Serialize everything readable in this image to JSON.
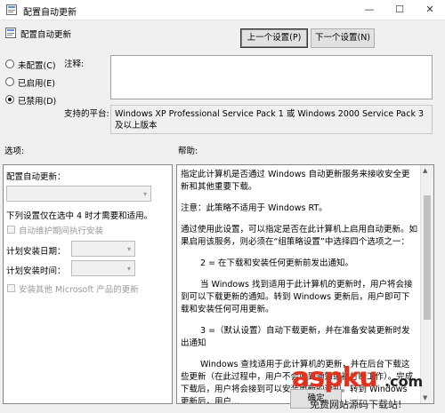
{
  "window": {
    "title": "配置自动更新",
    "minimize_glyph": "—",
    "maximize_glyph": "☐",
    "close_glyph": "✕"
  },
  "header": {
    "policy_name": "配置自动更新",
    "prev_button": "上一个设置(P)",
    "next_button": "下一个设置(N)"
  },
  "state_options": [
    {
      "label": "未配置(C)",
      "selected": false
    },
    {
      "label": "已启用(E)",
      "selected": false
    },
    {
      "label": "已禁用(D)",
      "selected": true
    }
  ],
  "comment": {
    "label": "注释:",
    "value": ""
  },
  "platform": {
    "label": "支持的平台:",
    "value": "Windows XP Professional Service Pack 1 或 Windows 2000 Service Pack 3 及以上版本"
  },
  "options": {
    "section_label": "选项:",
    "configure_label": "配置自动更新：",
    "configure_value": "",
    "desc": "下列设置仅在选中 4 时才需要和适用。",
    "maintenance_checkbox": "自动维护期间执行安装",
    "schedule_day_label": "计划安装日期：",
    "schedule_time_label": "计划安装时间：",
    "other_products_checkbox": "安装其他 Microsoft 产品的更新"
  },
  "help": {
    "section_label": "帮助:",
    "paragraphs": [
      "指定此计算机是否通过 Windows 自动更新服务来接收安全更新和其他重要下载。",
      "注意：此策略不适用于 Windows RT。",
      "通过使用此设置，可以指定是否在此计算机上启用自动更新。如果启用该服务，则必须在“组策略设置”中选择四个选项之一：",
      "2 = 在下载和安装任何更新前发出通知。",
      "当 Windows 找到适用于此计算机的更新时，用户将会接到可以下载更新的通知。转到 Windows 更新后，用户即可下载和安装任何可用更新。",
      "3 =（默认设置）自动下载更新，并在准备安装更新时发出通知",
      "Windows 查找适用于此计算机的更新，并在后台下载这些更新（在此过程中，用户不会收到通知或被打断工作）。完成下载后，用户将会接到可以安装更新的通知。转到 Windows 更新后，用户..."
    ]
  },
  "footer": {
    "ok_button": "确定"
  },
  "watermark": {
    "brand": "aspku",
    "tld": ".com",
    "subtitle": "免费网站源码下载站!"
  }
}
